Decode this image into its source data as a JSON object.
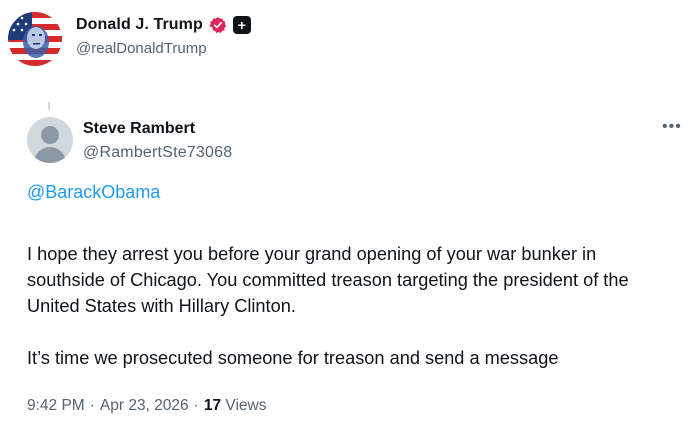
{
  "outer_author": {
    "name": "Donald J. Trump",
    "handle": "@realDonaldTrump",
    "affiliate_badge": "+",
    "verified_color": "#e0245e"
  },
  "tweet": {
    "author": {
      "name": "Steve Rambert",
      "handle": "@RambertSte73068"
    },
    "more_icon": "•••",
    "mention": "@BarackObama",
    "paragraphs": [
      "I hope they arrest you before your grand opening of your war bunker in southside of Chicago. You committed treason targeting the president of the United States with Hillary Clinton.",
      "It’s time we prosecuted someone for treason and send a message"
    ],
    "time": "9:42 PM",
    "sep1": "·",
    "date": "Apr 23, 2026",
    "sep2": "·",
    "views_count": "17",
    "views_label": "Views"
  },
  "colors": {
    "link": "#1d9bf0",
    "secondary_text": "#536471",
    "primary_text": "#0f1419"
  }
}
